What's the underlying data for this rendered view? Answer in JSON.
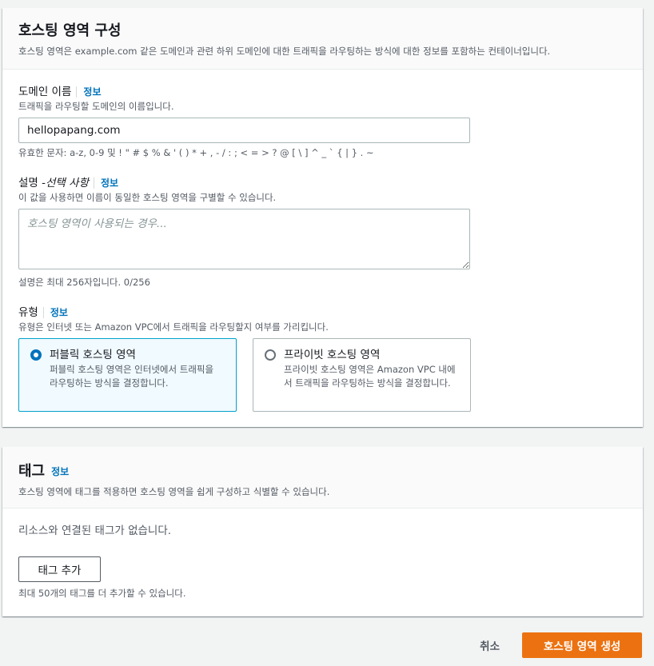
{
  "hosted_zone_config": {
    "title": "호스팅 영역 구성",
    "description": "호스팅 영역은 example.com 같은 도메인과 관련 하위 도메인에 대한 트래픽을 라우팅하는 방식에 대한 정보를 포함하는 컨테이너입니다.",
    "domain": {
      "label": "도메인 이름",
      "info": "정보",
      "description": "트래픽을 라우팅할 도메인의 이름입니다.",
      "value": "hellopapang.com",
      "constraint": "유효한 문자: a-z, 0-9 및 ! \" # $ % & ' ( ) * + , - / : ; < = > ? @ [ \\ ] ^ _ ` { | } . ~"
    },
    "description_field": {
      "label": "설명 - ",
      "label_optional": "선택 사항",
      "info": "정보",
      "description": "이 값을 사용하면 이름이 동일한 호스팅 영역을 구별할 수 있습니다.",
      "placeholder": "호스팅 영역이 사용되는 경우...",
      "value": "",
      "constraint": "설명은 최대 256자입니다. 0/256"
    },
    "type": {
      "label": "유형",
      "info": "정보",
      "description": "유형은 인터넷 또는 Amazon VPC에서 트래픽을 라우팅할지 여부를 가리킵니다.",
      "options": [
        {
          "title": "퍼블릭 호스팅 영역",
          "description": "퍼블릭 호스팅 영역은 인터넷에서 트래픽을 라우팅하는 방식을 결정합니다.",
          "selected": true
        },
        {
          "title": "프라이빗 호스팅 영역",
          "description": "프라이빗 호스팅 영역은 Amazon VPC 내에서 트래픽을 라우팅하는 방식을 결정합니다.",
          "selected": false
        }
      ]
    }
  },
  "tags": {
    "title": "태그",
    "info": "정보",
    "description": "호스팅 영역에 태그를 적용하면 호스팅 영역을 쉽게 구성하고 식별할 수 있습니다.",
    "empty_text": "리소스와 연결된 태그가 없습니다.",
    "add_button": "태그 추가",
    "limit_text": "최대 50개의 태그를 더 추가할 수 있습니다."
  },
  "footer": {
    "cancel": "취소",
    "create": "호스팅 영역 생성"
  },
  "colors": {
    "primary": "#ec7211",
    "link": "#0073bb",
    "selected_tile_bg": "#f1faff"
  }
}
